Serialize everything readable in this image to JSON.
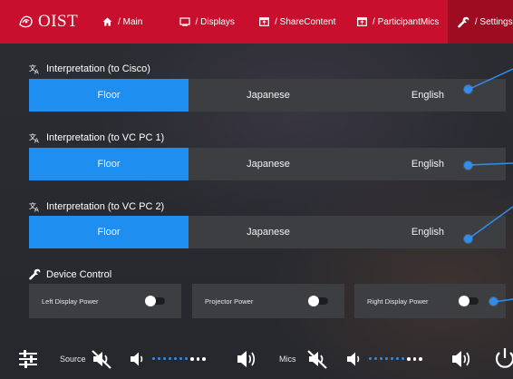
{
  "app": {
    "logo_text": "OIST"
  },
  "nav": [
    {
      "label": "/ Main",
      "icon": "home-icon",
      "active": false
    },
    {
      "label": "/ Displays",
      "icon": "display-icon",
      "active": false
    },
    {
      "label": "/ ShareContent",
      "icon": "share-content-icon",
      "active": false
    },
    {
      "label": "/ ParticipantMics",
      "icon": "participant-mics-icon",
      "active": false
    },
    {
      "label": "/ Settings",
      "icon": "wrench-icon",
      "active": true
    }
  ],
  "interpretation": [
    {
      "title": "Interpretation (to Cisco)",
      "options": [
        "Floor",
        "Japanese",
        "English"
      ],
      "selected": "Floor"
    },
    {
      "title": "Interpretation (to VC PC 1)",
      "options": [
        "Floor",
        "Japanese",
        "English"
      ],
      "selected": "Floor"
    },
    {
      "title": "Interpretation (to VC PC 2)",
      "options": [
        "Floor",
        "Japanese",
        "English"
      ],
      "selected": "Floor"
    }
  ],
  "device_control": {
    "title": "Device Control",
    "items": [
      {
        "label": "Left Display Power",
        "on": false
      },
      {
        "label": "Projector Power",
        "on": false
      },
      {
        "label": "Right Display Power",
        "on": false
      }
    ]
  },
  "bottom": {
    "source_label": "Source",
    "mics_label": "Mics",
    "source_level_dots": 7,
    "mics_level_dots": 7,
    "total_dots": 10
  },
  "colors": {
    "accent_red": "#c8102e",
    "selected_blue": "#1e8ff0",
    "panel": "#3c3e42"
  }
}
